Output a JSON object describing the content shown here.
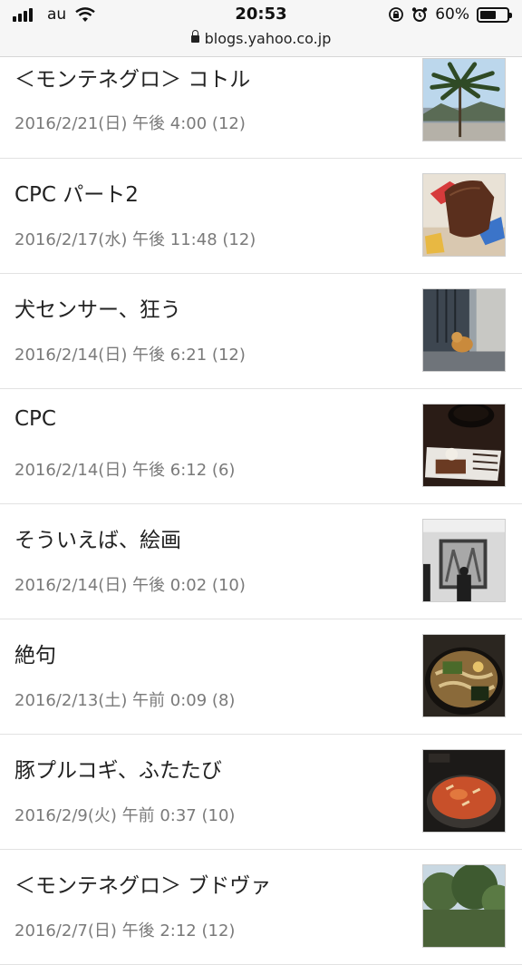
{
  "status_bar": {
    "carrier": "au",
    "time": "20:53",
    "battery_percent": "60%",
    "battery_level": 0.6,
    "url": "blogs.yahoo.co.jp"
  },
  "posts": [
    {
      "title": "＜モンテネグロ＞ コトル",
      "date": "2016/2/21(日) 午後 4:00 (12)",
      "thumb": "palm-tree-photo"
    },
    {
      "title": "CPC パート2",
      "date": "2016/2/17(水) 午後 11:48 (12)",
      "thumb": "cake-photo"
    },
    {
      "title": "犬センサー、狂う",
      "date": "2016/2/14(日) 午後 6:21 (12)",
      "thumb": "dog-photo"
    },
    {
      "title": "CPC",
      "date": "2016/2/14(日) 午後 6:12 (6)",
      "thumb": "dessert-plate-photo"
    },
    {
      "title": "そういえば、絵画",
      "date": "2016/2/14(日) 午後 0:02 (10)",
      "thumb": "painting-photo"
    },
    {
      "title": "絶句",
      "date": "2016/2/13(土) 午前 0:09 (8)",
      "thumb": "ramen-photo"
    },
    {
      "title": "豚プルコギ、ふたたび",
      "date": "2016/2/9(火) 午前 0:37 (10)",
      "thumb": "stew-photo"
    },
    {
      "title": "＜モンテネグロ＞ ブドヴァ",
      "date": "2016/2/7(日) 午後 2:12 (12)",
      "thumb": "trees-photo"
    }
  ]
}
